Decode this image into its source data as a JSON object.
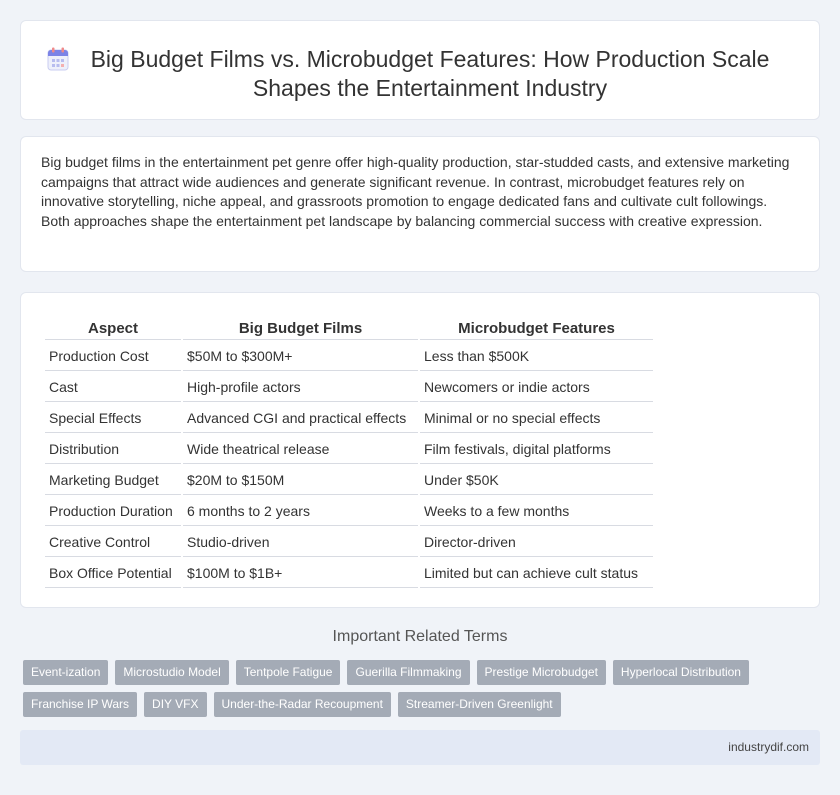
{
  "header": {
    "title_line1": "Big Budget Films vs. Microbudget Features: How Production Scale",
    "title_line2": "Shapes the Entertainment Industry",
    "icon": "calendar-icon"
  },
  "intro": {
    "text": "Big budget films in the entertainment pet genre offer high-quality production, star-studded casts, and extensive marketing campaigns that attract wide audiences and generate significant revenue. In contrast, microbudget features rely on innovative storytelling, niche appeal, and grassroots promotion to engage dedicated fans and cultivate cult followings. Both approaches shape the entertainment pet landscape by balancing commercial success with creative expression."
  },
  "table": {
    "headers": [
      "Aspect",
      "Big Budget Films",
      "Microbudget Features"
    ],
    "rows": [
      [
        "Production Cost",
        "$50M to $300M+",
        "Less than $500K"
      ],
      [
        "Cast",
        "High-profile actors",
        "Newcomers or indie actors"
      ],
      [
        "Special Effects",
        "Advanced CGI and practical effects",
        "Minimal or no special effects"
      ],
      [
        "Distribution",
        "Wide theatrical release",
        "Film festivals, digital platforms"
      ],
      [
        "Marketing Budget",
        "$20M to $150M",
        "Under $50K"
      ],
      [
        "Production Duration",
        "6 months to 2 years",
        "Weeks to a few months"
      ],
      [
        "Creative Control",
        "Studio-driven",
        "Director-driven"
      ],
      [
        "Box Office Potential",
        "$100M to $1B+",
        "Limited but can achieve cult status"
      ]
    ]
  },
  "related": {
    "title": "Important Related Terms",
    "tags": [
      "Event-ization",
      "Microstudio Model",
      "Tentpole Fatigue",
      "Guerilla Filmmaking",
      "Prestige Microbudget",
      "Hyperlocal Distribution",
      "Franchise IP Wars",
      "DIY VFX",
      "Under-the-Radar Recoupment",
      "Streamer-Driven Greenlight"
    ]
  },
  "footer": {
    "site": "industrydif.com"
  }
}
